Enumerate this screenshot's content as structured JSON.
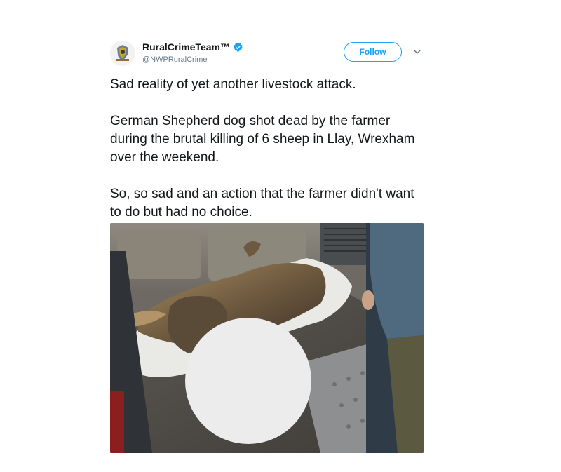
{
  "tweet": {
    "display_name": "RuralCrimeTeam™",
    "handle": "@NWPRuralCrime",
    "follow_label": "Follow",
    "text": "Sad reality of yet another livestock attack.\n\nGerman Shepherd dog shot dead by the farmer during the brutal killing of 6 sheep in Llay, Wrexham over the weekend.\n\nSo, so sad and an action that the farmer didn't want to do but had no choice.",
    "icons": {
      "avatar": "police-badge-avatar",
      "verified": "verified-badge-icon",
      "menu": "chevron-down-icon"
    },
    "colors": {
      "accent": "#1da1f2",
      "text": "#14171a",
      "secondary_text": "#657786"
    }
  }
}
